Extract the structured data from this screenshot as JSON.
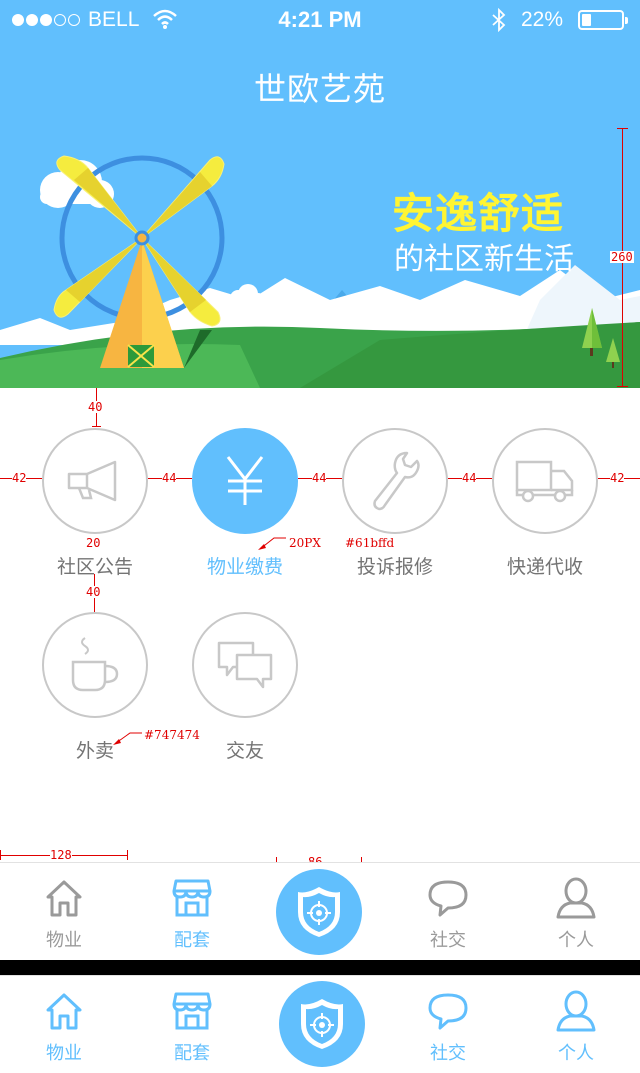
{
  "status_bar": {
    "carrier": "BELL",
    "time": "4:21 PM",
    "battery": "22%"
  },
  "header": {
    "title": "世欧艺苑",
    "slogan_main": "安逸舒适",
    "slogan_sub": "的社区新生活"
  },
  "features": [
    {
      "label": "社区公告",
      "icon": "megaphone-icon",
      "active": false
    },
    {
      "label": "物业缴费",
      "icon": "yen-icon",
      "active": true
    },
    {
      "label": "投诉报修",
      "icon": "wrench-icon",
      "active": false
    },
    {
      "label": "快递代收",
      "icon": "truck-icon",
      "active": false
    },
    {
      "label": "外卖",
      "icon": "coffee-cup-icon",
      "active": false
    },
    {
      "label": "交友",
      "icon": "chat-bubbles-icon",
      "active": false
    }
  ],
  "annotations": {
    "banner_height": "260",
    "gap_top": "40",
    "margin_left": "42",
    "gap_1": "44",
    "gap_2": "44",
    "gap_3": "44",
    "margin_right": "42",
    "label_gap": "20",
    "row_gap": "40",
    "font_size_note": "20PX",
    "active_color_note": "#61bffd",
    "text_color_note": "#747474",
    "tab_width": "128",
    "center_width": "86",
    "center_height": "86"
  },
  "tabbar_inactive": {
    "tabs": [
      {
        "label": "物业",
        "icon": "home-icon",
        "color": "gray"
      },
      {
        "label": "配套",
        "icon": "store-icon",
        "color": "blue"
      },
      {
        "label": "社交",
        "icon": "chat-icon",
        "color": "gray"
      },
      {
        "label": "个人",
        "icon": "person-icon",
        "color": "gray"
      }
    ],
    "center_icon": "shield-icon"
  },
  "tabbar_active": {
    "tabs": [
      {
        "label": "物业",
        "icon": "home-icon",
        "color": "blue"
      },
      {
        "label": "配套",
        "icon": "store-icon",
        "color": "blue"
      },
      {
        "label": "社交",
        "icon": "chat-icon",
        "color": "blue"
      },
      {
        "label": "个人",
        "icon": "person-icon",
        "color": "blue"
      }
    ],
    "center_icon": "shield-icon"
  },
  "colors": {
    "primary": "#61bffd",
    "text": "#747474",
    "slogan": "#fff533",
    "annotation": "#e00000"
  }
}
